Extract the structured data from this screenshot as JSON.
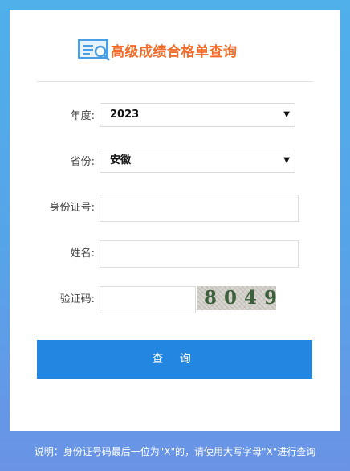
{
  "header": {
    "title": "高级成绩合格单查询",
    "logo_icon": "document-search-icon"
  },
  "form": {
    "year": {
      "label": "年度:",
      "value": "2023"
    },
    "province": {
      "label": "省份:",
      "value": "安徽"
    },
    "id_number": {
      "label": "身份证号:",
      "value": "",
      "placeholder": ""
    },
    "name": {
      "label": "姓名:",
      "value": "",
      "placeholder": ""
    },
    "captcha": {
      "label": "验证码:",
      "value": "",
      "image_text": "8049"
    },
    "submit_label": "查 询"
  },
  "footer": {
    "note": "说明：身份证号码最后一位为\"X\"的，请使用大写字母\"X\"进行查询"
  },
  "colors": {
    "title": "#f26d2b",
    "button": "#2386e0",
    "background": "#57a3e8"
  }
}
